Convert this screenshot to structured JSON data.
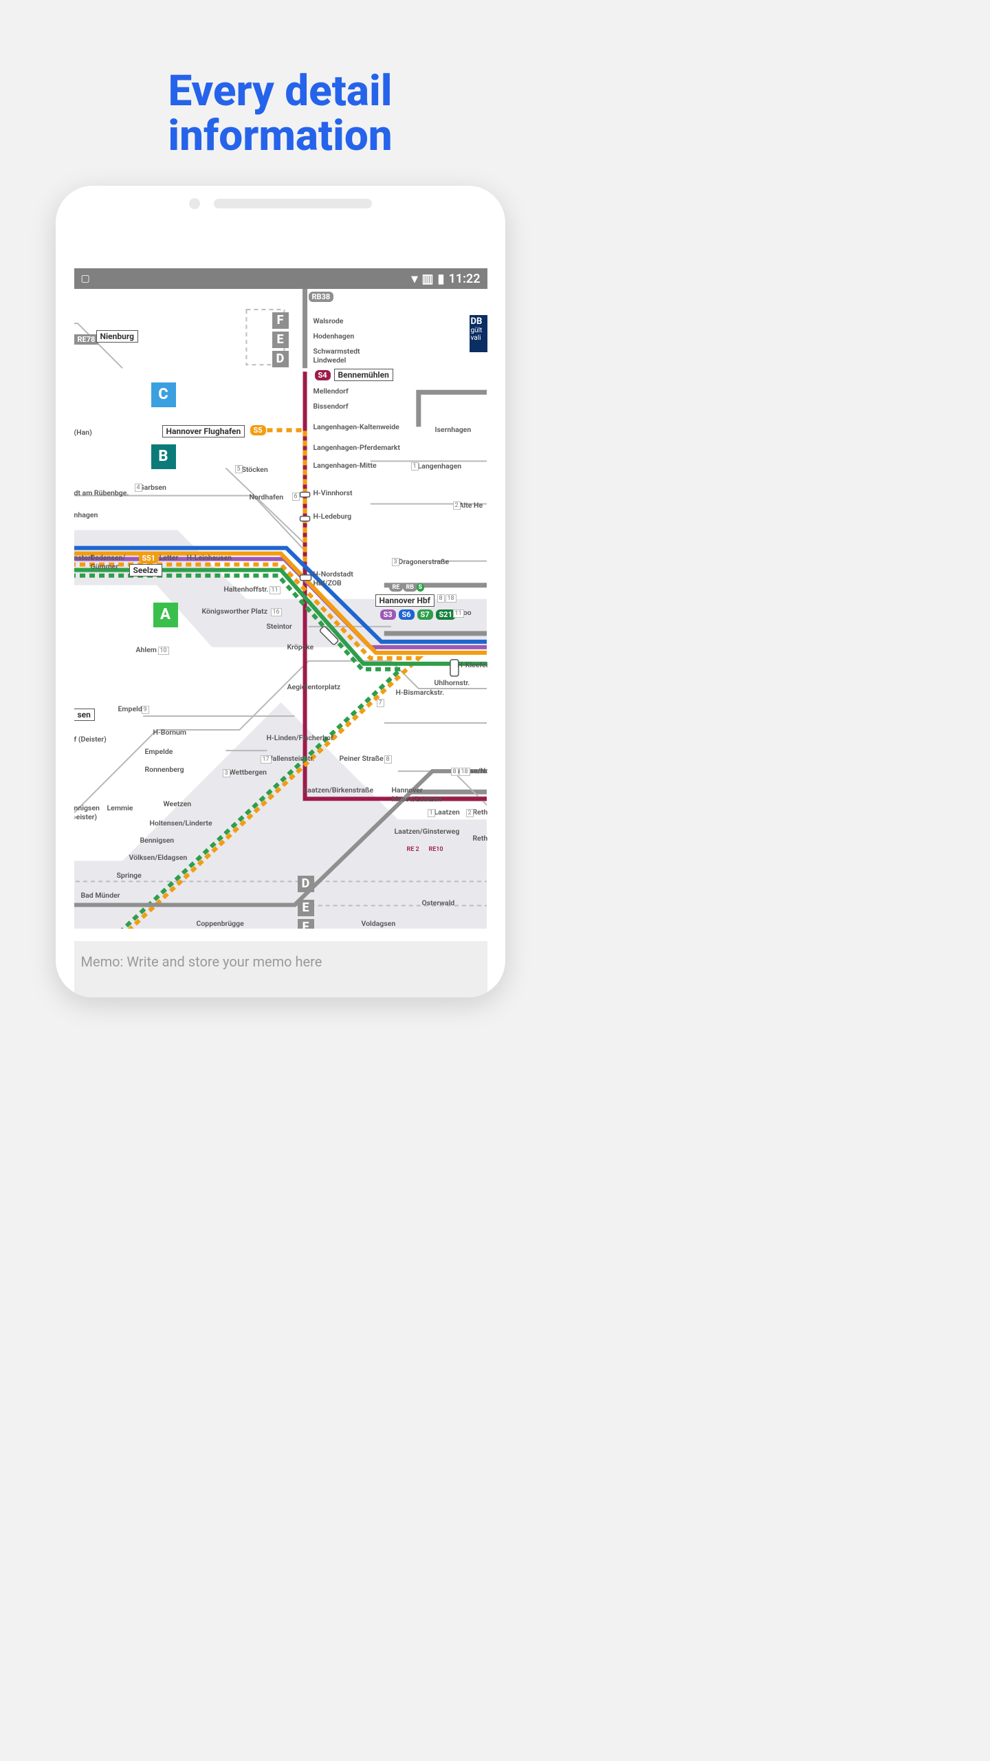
{
  "promo": {
    "headline_l1": "Every detail",
    "headline_l2": "information"
  },
  "statusbar": {
    "time": "11:22"
  },
  "memo": {
    "placeholder": "Memo: Write and store your memo here"
  },
  "colors": {
    "orange": "#f39c12",
    "green": "#2e9e4b",
    "purple": "#9b59b6",
    "magenta": "#9d1c4a",
    "blue": "#1e66d0",
    "gray": "#8f8f8f",
    "teal": "#0b7b7a",
    "red": "#b8232f"
  },
  "badges": {
    "rb38": "RB38",
    "re78": "RE78",
    "db": "DB",
    "db_sub1": "gült",
    "db_sub2": "vali",
    "re2": "RE 2",
    "re10": "RE10"
  },
  "zones": {
    "a": "A",
    "b": "B",
    "c": "C",
    "d": "D",
    "e": "E",
    "f": "F"
  },
  "lines": {
    "s4": "S4",
    "s5": "S5",
    "s51": "S51",
    "s3": "S3",
    "s6": "S6",
    "s7": "S7",
    "s21": "S21",
    "re": "RE",
    "rb": "RB",
    "s": "S"
  },
  "stations": {
    "nienburg": "Nienburg",
    "walsrode": "Walsrode",
    "hodenhagen": "Hodenhagen",
    "schwarmstedt": "Schwarmstedt\nLindwedel",
    "bennemuehlen": "Bennemühlen",
    "mellendorf": "Mellendorf",
    "bissendorf": "Bissendorf",
    "lk": "Langenhagen-Kaltenweide",
    "lp": "Langenhagen-Pferdemarkt",
    "lm": "Langenhagen-Mitte",
    "langenhagen": "Langenhagen",
    "hvinnhorst": "H-Vinnhorst",
    "hledeburg": "H-Ledeburg",
    "hnordstadt": "H-Nordstadt\nHbf/ZOB",
    "hannoverhbf": "Hannover Hbf",
    "zoo": "Zoo",
    "isernhagen": "Isernhagen",
    "altehe": "Alte He",
    "dragoner": "Dragonerstraße",
    "hkleefeld": "H-Kleefeld",
    "uhlhorns": "Uhlhornstr.",
    "hbismarck": "H-Bismarckstr.",
    "hnflughafen": "Hannover Flughafen",
    "stoecken": "Stöcken",
    "garbsen": "Garbsen",
    "ruebenbge": "dt am Rübenbge.",
    "nhagen": "nhagen",
    "han": "(Han)",
    "nordhafen": "Nordhafen",
    "nstorf": "nstorf",
    "dedensen": "Dedensen/\nGümmer",
    "letter": "Letter",
    "leinhausen": "H-Leinhausen",
    "seelze": "Seelze",
    "haltenhoff": "Haltenhoffstr.",
    "koenigsw": "Königsworther Platz",
    "steintor": "Steintor",
    "kroepcke": "Kröpcke",
    "aegi": "Aegidientorplatz",
    "ahlem": "Ahlem",
    "empeld": "Empelde",
    "empelde2": "Empelde",
    "hbornum": "H-Bornum",
    "hlinfisch": "H-Linden/Fischerhof",
    "wallenstein": "Wallensteinstr.",
    "wettbergen": "Wettbergen",
    "peiner": "Peiner Straße",
    "sen": "sen",
    "fdeister": "f (Deister)",
    "nnigsen": "nnigsen\n›eister)",
    "lemmie": "Lemmie",
    "weetzen": "Weetzen",
    "holtensen": "Holtensen/Linderte",
    "bennigsen": "Bennigsen",
    "voelksen": "Völksen/Eldagsen",
    "ronnenberg": "Ronnenberg",
    "springe": "Springe",
    "badmuender": "Bad Münder",
    "coppenbruegge": "Coppenbrügge",
    "voldagsen": "Voldagsen",
    "osterwald": "Osterwald",
    "messe": "Hannover\nMesse/Laatzen",
    "messe_nord": "Messe/Nord",
    "laatzen_birken": "Laatzen/Birkenstraße",
    "laatzen": "Laatzen",
    "laatzen_ginster": "Laatzen/Ginsterweg",
    "rethen1": "Reth",
    "rethen2": "Rethe"
  },
  "tram_nums": {
    "n1": "1",
    "n2": "2",
    "n3": "3",
    "n4": "4",
    "n5": "5",
    "n6": "6",
    "n7": "7",
    "n8": "8",
    "n9": "9",
    "n10": "10",
    "n11": "11",
    "n16": "16",
    "n17": "17",
    "n18": "18"
  }
}
